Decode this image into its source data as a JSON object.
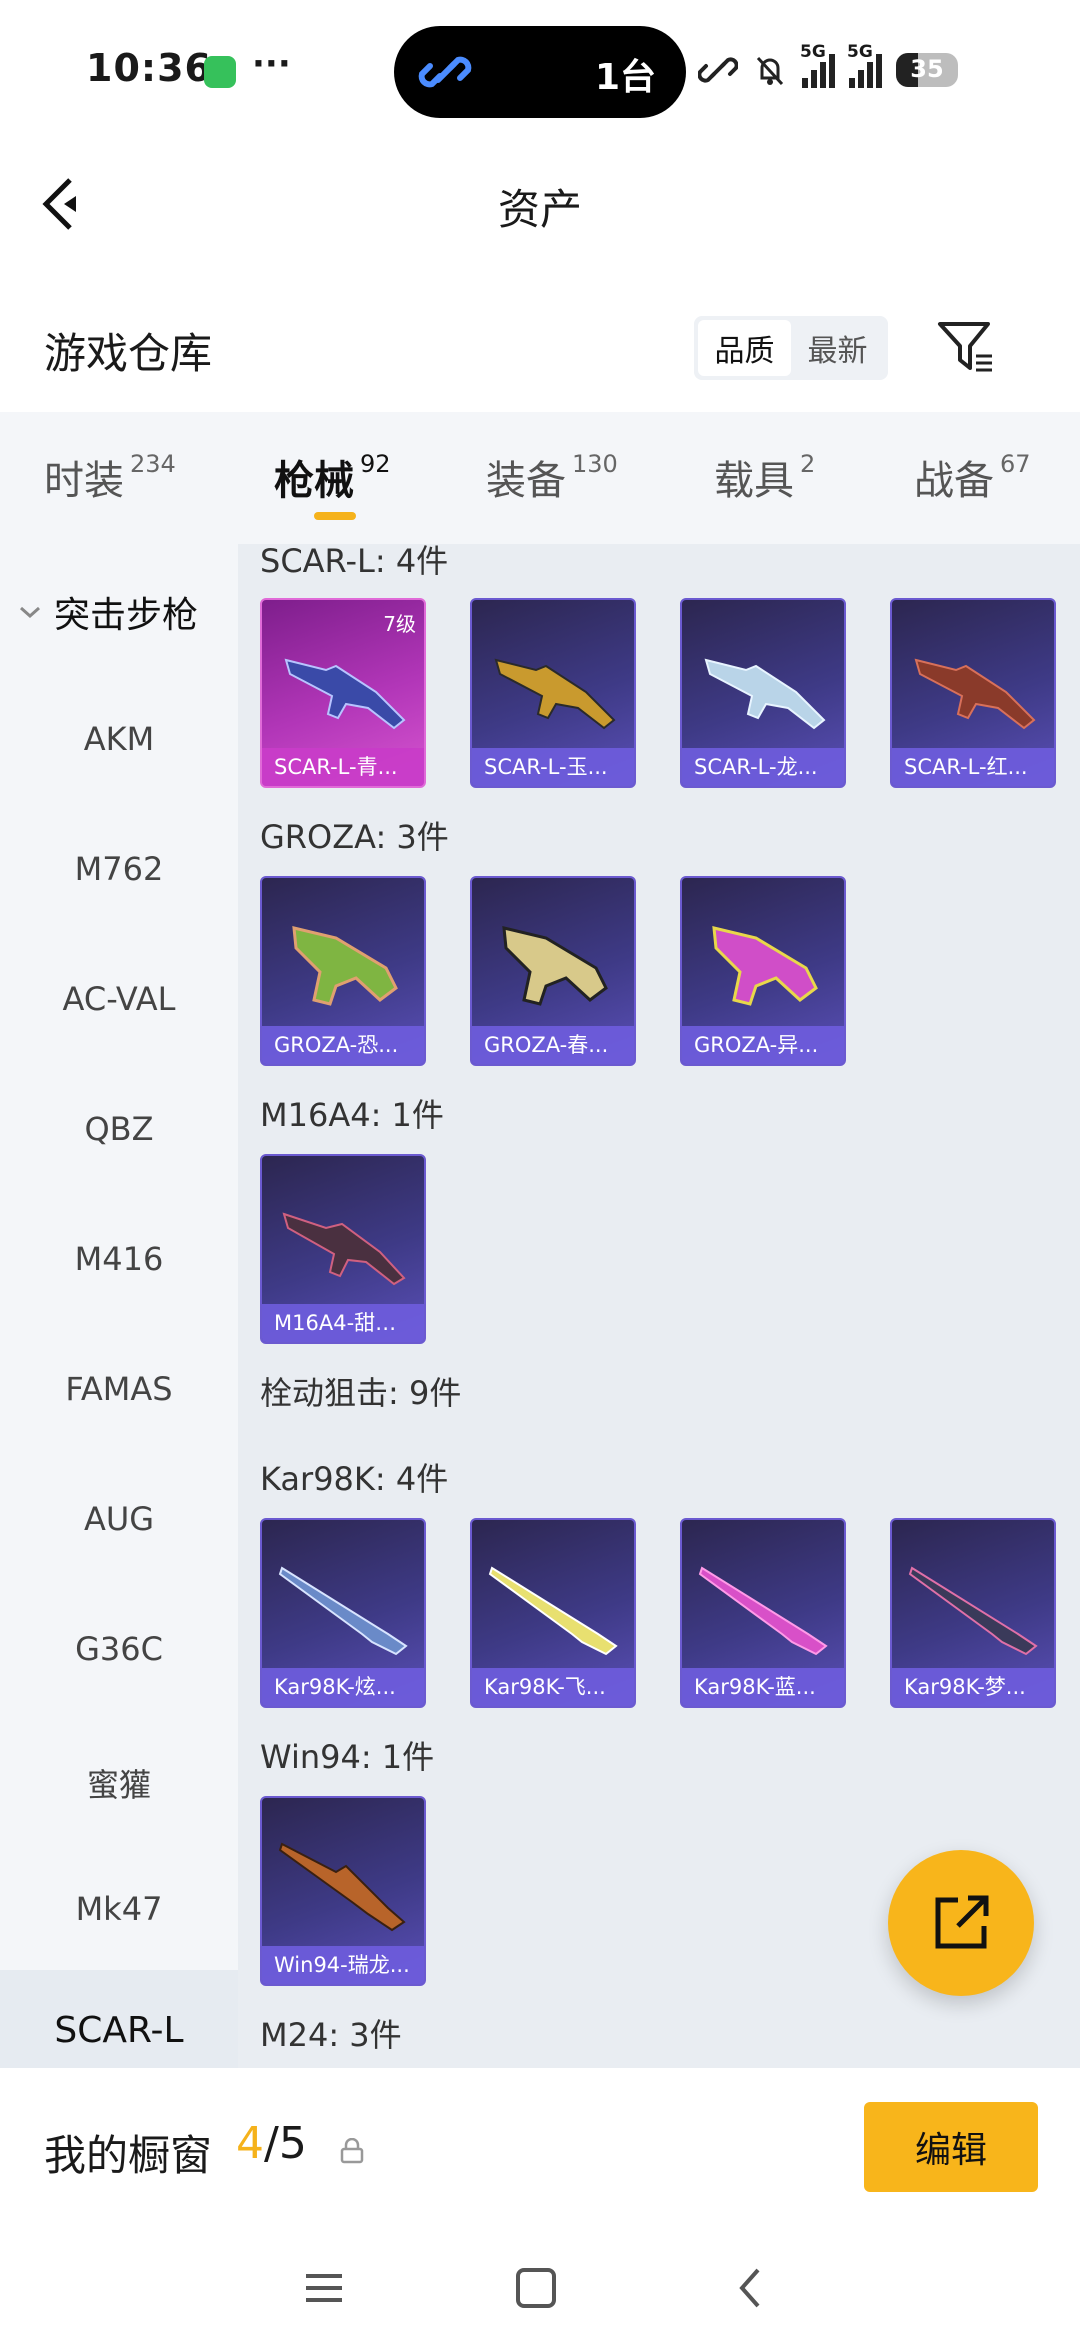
{
  "status_bar": {
    "time": "10:36",
    "more": "···",
    "island_text": "1台",
    "network": "5G",
    "battery": "35",
    "battery_level": 0.35
  },
  "header": {
    "title": "资产"
  },
  "warehouse": {
    "title": "游戏仓库",
    "sort_options": [
      "品质",
      "最新"
    ],
    "active_sort": "品质"
  },
  "tabs": [
    {
      "label": "时装",
      "count": "234"
    },
    {
      "label": "枪械",
      "count": "92",
      "active": true
    },
    {
      "label": "装备",
      "count": "130"
    },
    {
      "label": "载具",
      "count": "2"
    },
    {
      "label": "战备",
      "count": "67"
    }
  ],
  "sidebar": {
    "category": "突击步枪",
    "items": [
      "AKM",
      "M762",
      "AC-VAL",
      "QBZ",
      "M416",
      "FAMAS",
      "AUG",
      "G36C",
      "蜜獾",
      "Mk47",
      "SCAR-L"
    ],
    "selected": "SCAR-L"
  },
  "content": {
    "groups": [
      {
        "label": "SCAR-L: 4件",
        "items": [
          {
            "name": "SCAR-L-青...",
            "level": "7级",
            "style": "pink"
          },
          {
            "name": "SCAR-L-玉...",
            "style": "blue"
          },
          {
            "name": "SCAR-L-龙...",
            "style": "blue"
          },
          {
            "name": "SCAR-L-红...",
            "style": "blue"
          }
        ]
      },
      {
        "label": "GROZA: 3件",
        "items": [
          {
            "name": "GROZA-恐...",
            "style": "blue"
          },
          {
            "name": "GROZA-春...",
            "style": "blue"
          },
          {
            "name": "GROZA-异...",
            "style": "blue"
          }
        ]
      },
      {
        "label": "M16A4: 1件",
        "items": [
          {
            "name": "M16A4-甜心...",
            "style": "blue"
          }
        ]
      },
      {
        "label": "栓动狙击: 9件",
        "items": []
      },
      {
        "label": "Kar98K: 4件",
        "items": [
          {
            "name": "Kar98K-炫...",
            "style": "blue"
          },
          {
            "name": "Kar98K-飞...",
            "style": "blue"
          },
          {
            "name": "Kar98K-蓝...",
            "style": "blue"
          },
          {
            "name": "Kar98K-梦...",
            "style": "blue"
          }
        ]
      },
      {
        "label": "Win94: 1件",
        "items": [
          {
            "name": "Win94-瑞龙...",
            "style": "blue"
          }
        ]
      },
      {
        "label": "M24: 3件",
        "items": []
      }
    ]
  },
  "showcase": {
    "title": "我的橱窗",
    "current": "4",
    "total": "/5",
    "edit_label": "编辑"
  },
  "colors": {
    "accent": "#f8b51b",
    "card_blue": "#3e3a86",
    "card_pink": "#b236b8"
  }
}
